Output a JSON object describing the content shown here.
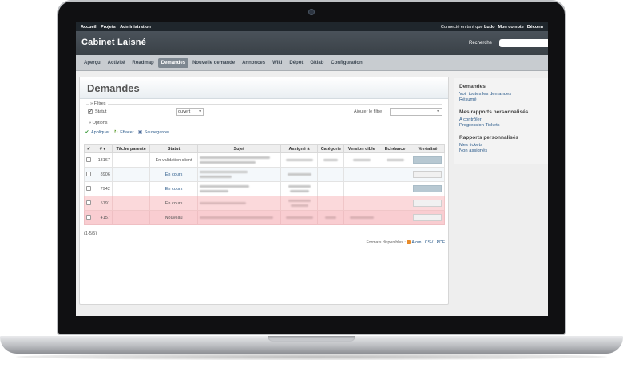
{
  "top_menu": {
    "left": [
      "Accueil",
      "Projets",
      "Administration"
    ],
    "logged_in_prefix": "Connecté en tant que",
    "user": "Ludo",
    "my_account": "Mon compte",
    "logout": "Déconn"
  },
  "header": {
    "title": "Cabinet Laisné",
    "search_label": "Recherche :"
  },
  "main_menu": [
    "Aperçu",
    "Activité",
    "Roadmap",
    "Demandes",
    "Nouvelle demande",
    "Annonces",
    "Wiki",
    "Dépôt",
    "Gitlab",
    "Configuration"
  ],
  "active_tab": "Demandes",
  "page": {
    "title": "Demandes",
    "filters_legend": "» Filtres",
    "status_label": "Statut",
    "status_value": "ouvert",
    "add_filter_label": "Ajouter le filtre",
    "options_label": "» Options",
    "apply": "Appliquer",
    "clear": "Effacer",
    "save": "Sauvegarder"
  },
  "table": {
    "columns": [
      "#",
      "Tâche parente",
      "Statut",
      "Sujet",
      "Assigné à",
      "Catégorie",
      "Version cible",
      "Echéance",
      "% réalisé"
    ],
    "check_header": "✓",
    "rows": [
      {
        "id": "13167",
        "status": "En validation client",
        "done": true
      },
      {
        "id": "8906",
        "status": "En cours",
        "done": false
      },
      {
        "id": "7942",
        "status": "En cours",
        "done": true
      },
      {
        "id": "5791",
        "status": "En cours",
        "done": false
      },
      {
        "id": "4157",
        "status": "Nouveau",
        "done": false
      }
    ]
  },
  "pagination": "(1-5/5)",
  "formats": {
    "label": "Formats disponibles :",
    "atom": "Atom",
    "csv": "CSV",
    "pdf": "PDF"
  },
  "sidebar": {
    "section1": {
      "title": "Demandes",
      "links": [
        "Voir toutes les demandes",
        "Résumé"
      ]
    },
    "section2": {
      "title": "Mes rapports personnalisés",
      "links": [
        "A contrôler",
        "Progression Tickets"
      ]
    },
    "section3": {
      "title": "Rapports personnalisés",
      "links": [
        "Mes tickets",
        "Non assignés"
      ]
    }
  }
}
